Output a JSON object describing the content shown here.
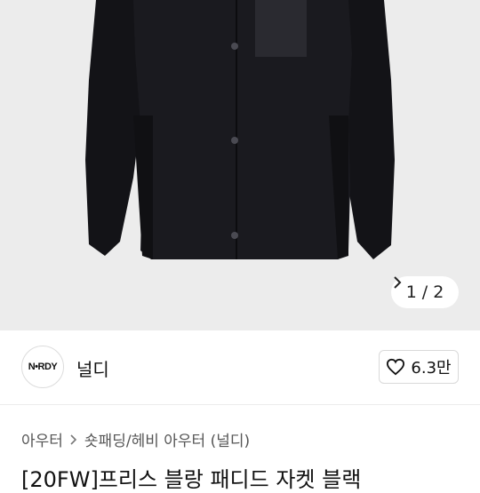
{
  "product_image": {
    "pager": {
      "current": "1",
      "separator": "/",
      "total": "2"
    }
  },
  "seller": {
    "logo_text": "N•RDY",
    "name": "널디",
    "like_count": "6.3만"
  },
  "breadcrumb": {
    "items": [
      "아우터",
      "숏패딩/헤비 아우터 (널디)"
    ]
  },
  "product": {
    "title": "[20FW]프리스 블랑 패디드 자켓 블랙"
  },
  "colors": {
    "hero_bg": "#ececec",
    "jacket": "#17171b",
    "text": "#111111"
  }
}
